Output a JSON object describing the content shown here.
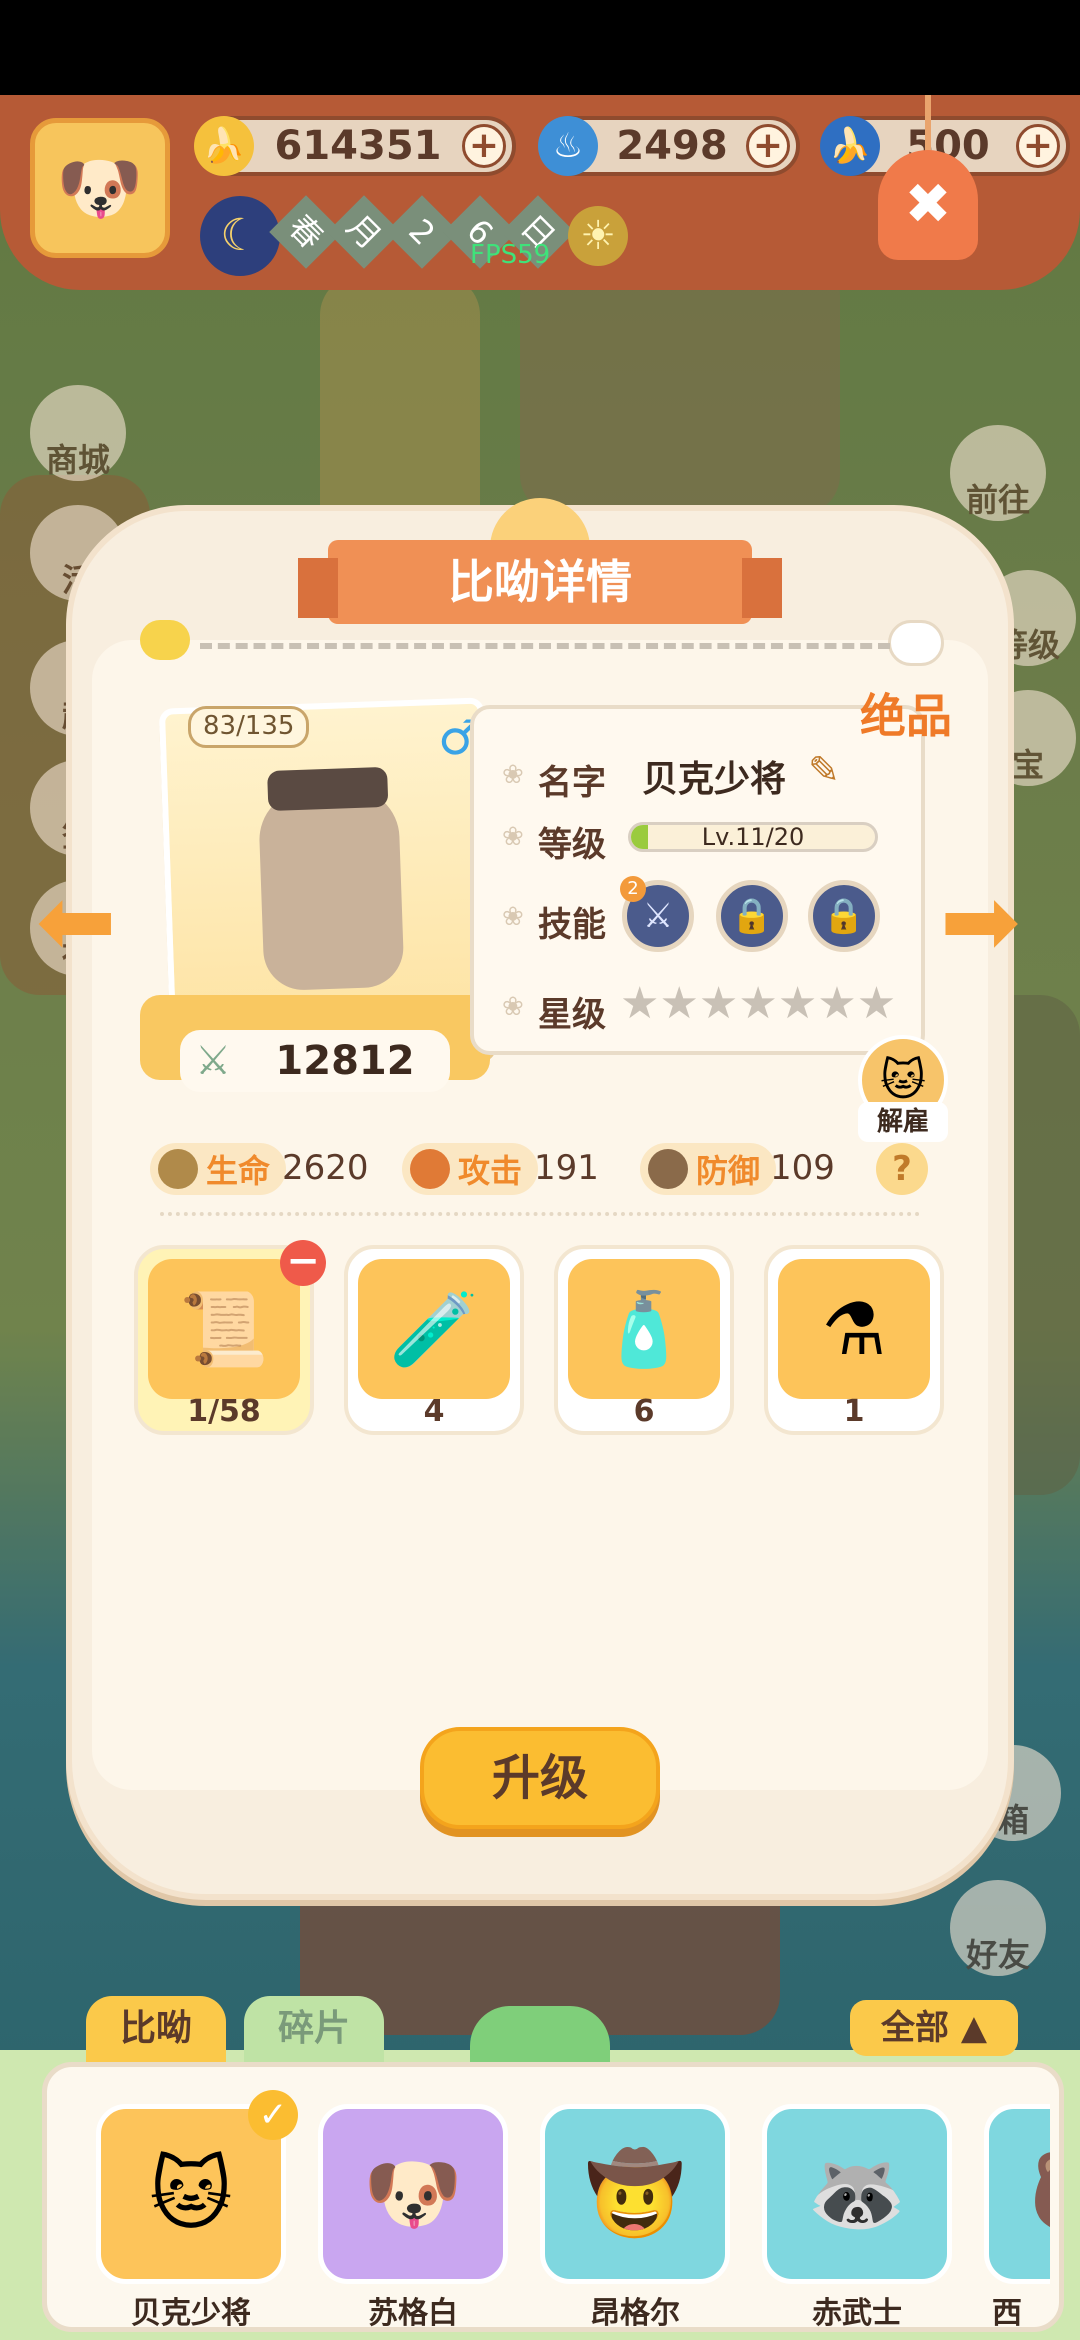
{
  "resources": [
    {
      "icon": "banana-icon",
      "value": "614351",
      "color": "#f5c13c"
    },
    {
      "icon": "blue-flame-icon",
      "value": "2498",
      "color": "#3e8fd6"
    },
    {
      "icon": "blue-banana-icon",
      "value": "500",
      "color": "#2f6fc2"
    }
  ],
  "season": {
    "spring": "春",
    "month": "月",
    "num1": "2",
    "num2": "6",
    "day": "日"
  },
  "fps": "FPS59",
  "side_left": [
    "商城",
    "活",
    "超",
    "签",
    "社"
  ],
  "side_right": [
    "前往",
    "等级",
    "箱",
    "好友"
  ],
  "side_right_partial": "宝",
  "card": {
    "title": "比呦详情",
    "exp": "83/135",
    "rarity": "绝品",
    "gender": "♂",
    "power": "12812",
    "dismiss": "解雇",
    "rows": {
      "name_label": "名字",
      "name_value": "贝克少将",
      "level_label": "等级",
      "level_value": "Lv.11/20",
      "skill_label": "技能",
      "skill_badge": "2",
      "star_label": "星级"
    },
    "level_progress": 0.07,
    "stats": [
      {
        "label": "生命",
        "value": "2620",
        "icon": "life-icon"
      },
      {
        "label": "攻击",
        "value": "191",
        "icon": "attack-icon"
      },
      {
        "label": "防御",
        "value": "109",
        "icon": "defense-icon"
      }
    ],
    "help": "?",
    "items": [
      {
        "icon": "scroll-icon",
        "glyph": "📜",
        "count": "1/58"
      },
      {
        "icon": "green-potion-icon",
        "glyph": "🧪",
        "count": "4"
      },
      {
        "icon": "blue-potion-icon",
        "glyph": "🧴",
        "count": "6"
      },
      {
        "icon": "purple-potion-icon",
        "glyph": "⚗",
        "count": "1"
      }
    ],
    "upgrade": "升级"
  },
  "bottom": {
    "tab_biyou": "比呦",
    "tab_fragments": "碎片",
    "filter": "全部",
    "heroes": [
      {
        "name": "贝克少将",
        "color": "#fdc45a",
        "glyph": "🐱"
      },
      {
        "name": "苏格白",
        "color": "#c9a6f0",
        "glyph": "🐶"
      },
      {
        "name": "昂格尔",
        "color": "#7fd7df",
        "glyph": "🤠"
      },
      {
        "name": "赤武士",
        "color": "#7fd7df",
        "glyph": "🦝"
      },
      {
        "name": "西",
        "color": "#7fd7df",
        "glyph": "🐻"
      }
    ]
  }
}
